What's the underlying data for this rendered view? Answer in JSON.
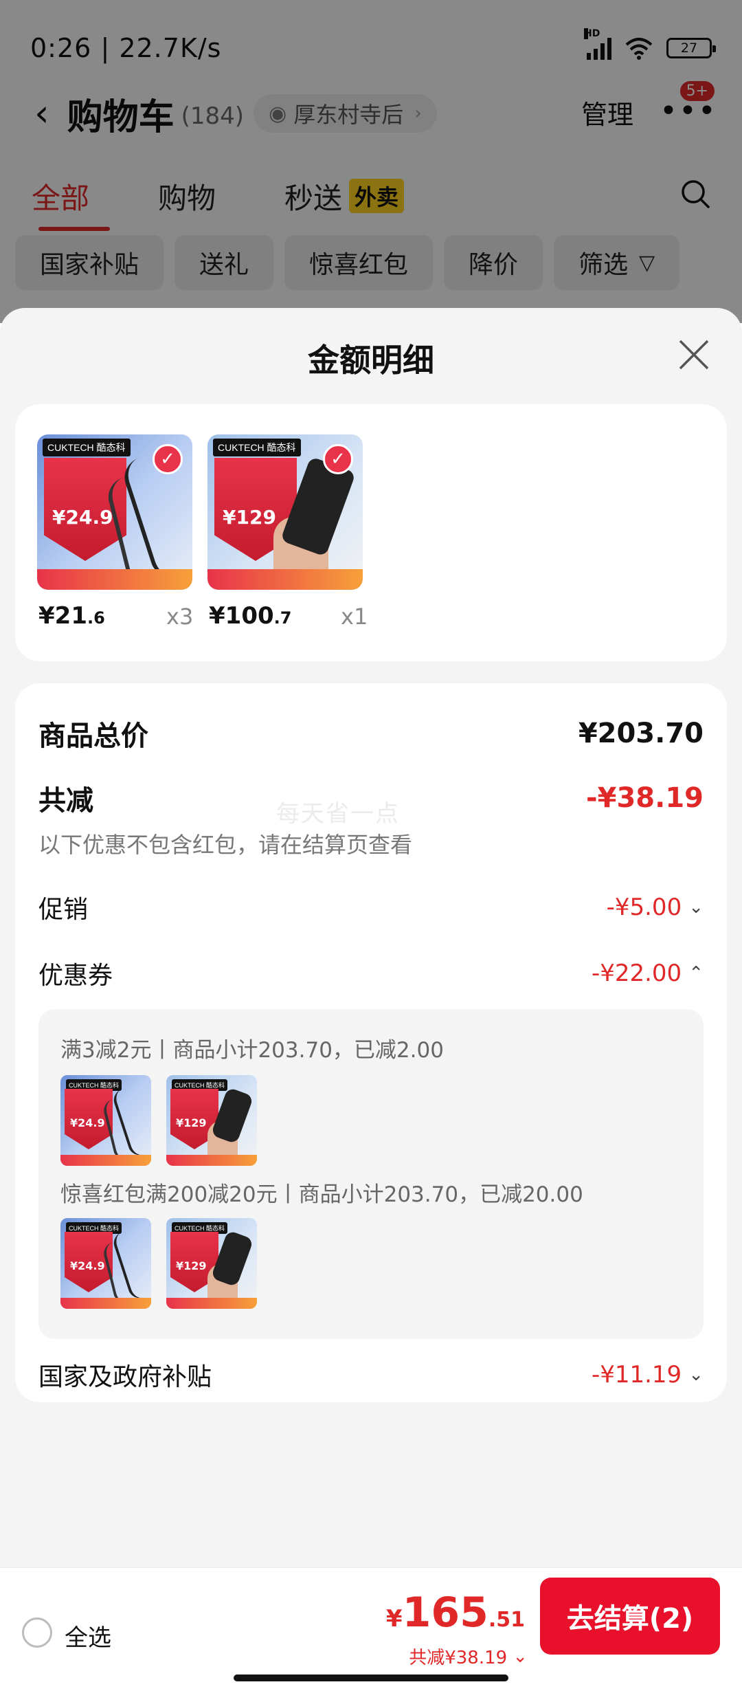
{
  "status": {
    "time": "0:26",
    "speed": "22.7K/s",
    "network": "HD",
    "battery": "27"
  },
  "header": {
    "title": "购物车",
    "count": "(184)",
    "location": "厚东村寺后",
    "manage": "管理",
    "badge": "5+"
  },
  "tabs": [
    {
      "label": "全部"
    },
    {
      "label": "购物"
    },
    {
      "label": "秒送"
    }
  ],
  "tab_tag": "外卖",
  "filters": [
    {
      "label": "国家补贴"
    },
    {
      "label": "送礼"
    },
    {
      "label": "惊喜红包"
    },
    {
      "label": "降价"
    },
    {
      "label": "筛选"
    }
  ],
  "sheet": {
    "title": "金额明细",
    "products": [
      {
        "brand": "CUKTECH 酷态科",
        "banner_price": "¥24.9",
        "price_main": "¥21",
        "price_dec": ".6",
        "qty": "x3"
      },
      {
        "brand": "CUKTECH 酷态科",
        "banner_price": "¥129",
        "price_main": "¥100",
        "price_dec": ".7",
        "qty": "x1"
      }
    ],
    "summary": {
      "total_label": "商品总价",
      "total_value": "¥203.70",
      "reduce_label": "共减",
      "reduce_value": "-¥38.19",
      "watermark": "每天省一点",
      "note": "以下优惠不包含红包，请在结算页查看",
      "promo_label": "促销",
      "promo_value": "-¥5.00",
      "coupon_label": "优惠券",
      "coupon_value": "-¥22.00",
      "coupon_line1": "满3减2元丨商品小计203.70，已减2.00",
      "coupon_line2": "惊喜红包满200减20元丨商品小计203.70，已减20.00",
      "subsidy_label": "国家及政府补贴",
      "subsidy_value": "-¥11.19"
    }
  },
  "bottom": {
    "select_all": "全选",
    "yen": "¥",
    "total_int": "165",
    "total_dec": ".51",
    "saved": "共减¥38.19",
    "checkout": "去结算(2)"
  }
}
